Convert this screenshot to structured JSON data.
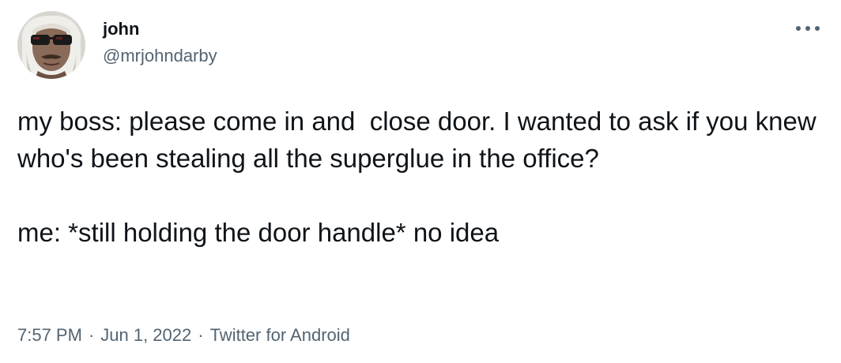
{
  "author": {
    "display_name": "john",
    "username": "@mrjohndarby",
    "avatar_icon": "profile-photo"
  },
  "actions": {
    "more_icon": "more-horizontal-icon",
    "more_color": "#536471"
  },
  "tweet": {
    "text": "my boss: please come in and  close door. I wanted to ask if you knew who's been stealing all the superglue in the office?\n\nme: *still holding the door handle* no idea"
  },
  "meta": {
    "time": "7:57 PM",
    "separator": "·",
    "date": "Jun 1, 2022",
    "source": "Twitter for Android"
  },
  "colors": {
    "text_primary": "#0f1419",
    "text_secondary": "#536471",
    "background": "#ffffff"
  }
}
